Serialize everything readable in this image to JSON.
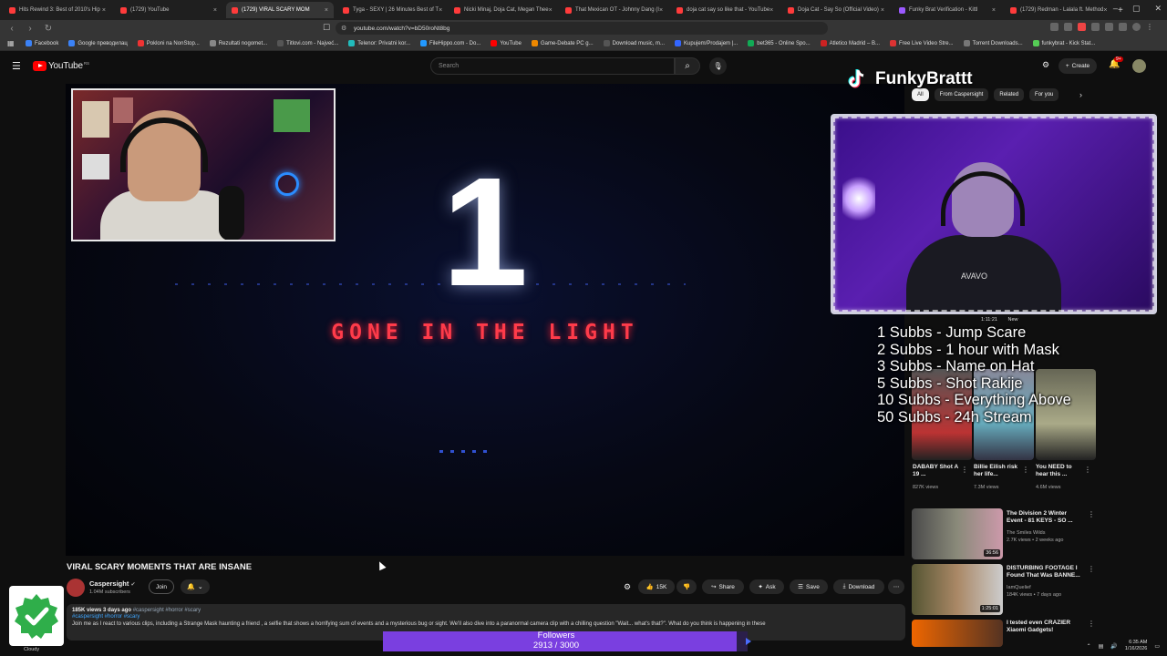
{
  "browser": {
    "tabs": [
      {
        "label": "Hits Rewind 3: Best of 2010's Hip"
      },
      {
        "label": "(1729) YouTube"
      },
      {
        "label": "(1729) VIRAL SCARY MOM",
        "active": true
      },
      {
        "label": "Tyga - SEXY | 26 Minutes Best of T"
      },
      {
        "label": "Nicki Minaj, Doja Cat, Megan Thee"
      },
      {
        "label": "That Mexican OT - Johnny Dang (I"
      },
      {
        "label": "doja cat say so like that - YouTube"
      },
      {
        "label": "Doja Cat - Say So (Official Video)"
      },
      {
        "label": "Funky Brat Verification - Kittl"
      },
      {
        "label": "(1729) Redman - Lalala ft. Method"
      }
    ],
    "url": "youtube.com/watch?v=bD50roNt8bg",
    "bookmarks": [
      "Facebook",
      "Google преводилац",
      "Pokloni na NonStop...",
      "Rezultati nogomet...",
      "Titlovi.com - Najveć...",
      "Telenor: Privatni kor...",
      "FileHippo.com - Do...",
      "YouTube",
      "Game-Debate PC g...",
      "Download music, m...",
      "Kupujem/Prodajem |...",
      "bet365 - Online Spo...",
      "Atletico Madrid – B...",
      "Free Live Video Stre...",
      "Torrent Downloads...",
      "funkybrat - Kick Stat..."
    ]
  },
  "youtube": {
    "logo_text": "YouTube",
    "region": "RS",
    "search_placeholder": "Search",
    "create_label": "Create",
    "notif_count": "9+"
  },
  "video": {
    "big_number": "1",
    "subtitle": "GONE IN THE LIGHT",
    "title": "VIRAL SCARY MOMENTS THAT ARE INSANE",
    "channel": "Caspersight",
    "subscribers": "1.04M subscribers",
    "join_label": "Join",
    "likes": "15K",
    "share_label": "Share",
    "ask_label": "Ask",
    "save_label": "Save",
    "download_label": "Download",
    "views_date": "185K views  3 days ago",
    "hashtags_meta": "#caspersight #horror #scary",
    "hashtags": "#caspersight #horror #scary",
    "description": "Join me as I react to various clips, including a Strange Mask haunting a friend , a selfie that shows a horrifying sum of events and a mysterious bug or sight. We'll also dive into a paranormal camera clip with a chilling question \"Wait... what's that?\". What do you think is happening in these"
  },
  "sidebar": {
    "chips": [
      "All",
      "From Caspersight",
      "Related",
      "For you"
    ],
    "shorts": [
      {
        "title": "DABABY Shot A 19 ...",
        "views": "827K views"
      },
      {
        "title": "Billie Eilish risk her life...",
        "views": "7.3M views"
      },
      {
        "title": "You NEED to hear this ...",
        "views": "4.6M views"
      }
    ],
    "videos": [
      {
        "title": "The Division 2 Winter Event - 81 KEYS - SO ...",
        "channel": "The Smiles Wilds",
        "meta": "2.7K views • 2 weeks ago",
        "duration": "36:56"
      },
      {
        "title": "DISTURBING FOOTAGE I Found That Was BANNE...",
        "channel": "IamQuelief",
        "meta": "184K views • 7 days ago",
        "duration": "1:25:01"
      },
      {
        "title": "I tested even CRAZIER Xiaomi Gadgets!",
        "channel": "",
        "meta": "",
        "duration": ""
      }
    ],
    "mini_label": "1:11:21",
    "mini_new": "New"
  },
  "overlay": {
    "streamer_name": "FunkyBrattt",
    "rules": [
      "1 Subbs - Jump Scare",
      "2 Subbs - 1 hour with Mask",
      "3 Subbs - Name on Hat",
      "5 Subbs - Shot Rakije",
      "10 Subbs - Everything Above",
      "50 Subbs - 24h Stream"
    ],
    "followers_label": "Followers",
    "followers_text": "2913 / 3000",
    "followers_current": 2913,
    "followers_goal": 3000,
    "shirt_text": "AVAVO"
  },
  "taskbar": {
    "time": "6:35 AM",
    "date": "1/16/2026",
    "weather": "Cloudy"
  },
  "colors": {
    "yt_red": "#ff0000",
    "accent_purple": "#7a3fe0",
    "subtitle_red": "#ff3b4a",
    "link_blue": "#3ea6ff"
  }
}
